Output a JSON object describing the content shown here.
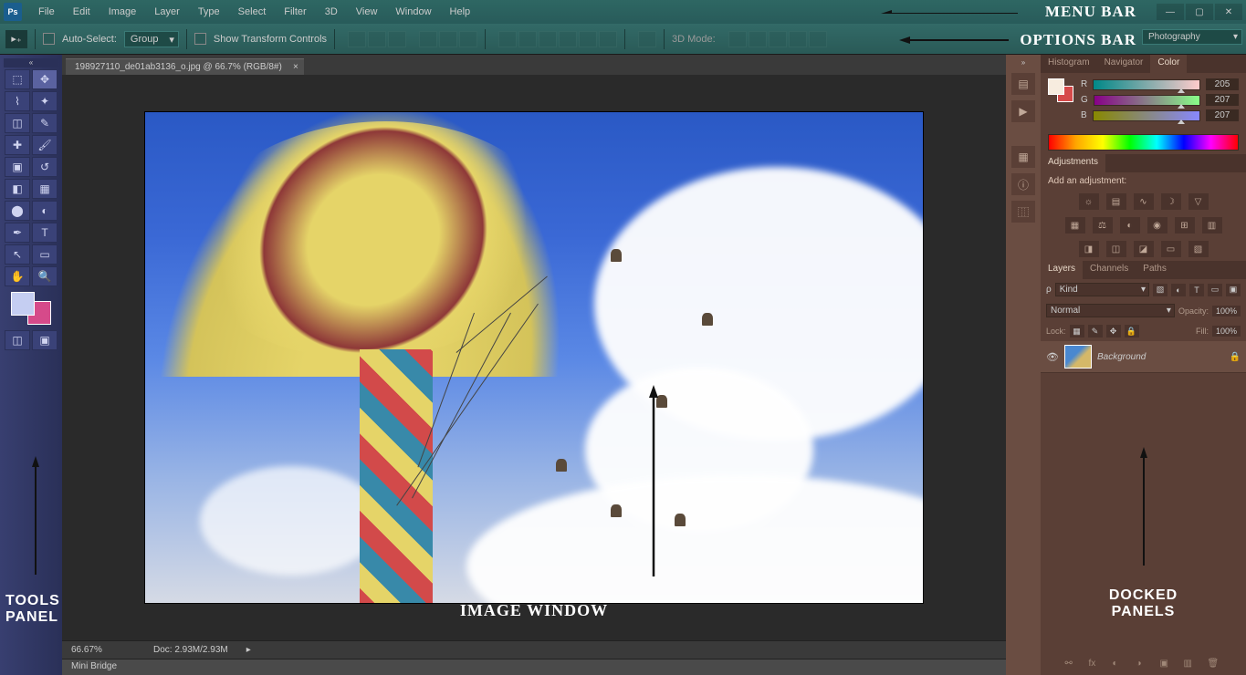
{
  "menu": {
    "logo": "Ps",
    "items": [
      "File",
      "Edit",
      "Image",
      "Layer",
      "Type",
      "Select",
      "Filter",
      "3D",
      "View",
      "Window",
      "Help"
    ],
    "annotation": "MENU BAR"
  },
  "options": {
    "auto_select": "Auto-Select:",
    "group_dd": "Group",
    "show_transform": "Show Transform Controls",
    "mode_3d": "3D Mode:",
    "workspace": "Photography",
    "annotation": "OPTIONS BAR"
  },
  "tools": {
    "annotation_line1": "TOOLS",
    "annotation_line2": "PANEL"
  },
  "doc": {
    "tab": "198927110_de01ab3136_o.jpg @ 66.7% (RGB/8#)",
    "zoom": "66.67%",
    "docsize": "Doc: 2.93M/2.93M",
    "minibridge": "Mini Bridge",
    "annotation": "IMAGE WINDOW"
  },
  "color": {
    "tabs": [
      "Histogram",
      "Navigator",
      "Color"
    ],
    "r_label": "R",
    "r_val": "205",
    "g_label": "G",
    "g_val": "207",
    "b_label": "B",
    "b_val": "207"
  },
  "adjustments": {
    "tab": "Adjustments",
    "add": "Add an adjustment:"
  },
  "layers": {
    "tabs": [
      "Layers",
      "Channels",
      "Paths"
    ],
    "kind": "Kind",
    "blend": "Normal",
    "opacity_label": "Opacity:",
    "opacity_val": "100%",
    "lock_label": "Lock:",
    "fill_label": "Fill:",
    "fill_val": "100%",
    "layer_name": "Background"
  },
  "docked": {
    "annotation_line1": "DOCKED",
    "annotation_line2": "PANELS"
  }
}
